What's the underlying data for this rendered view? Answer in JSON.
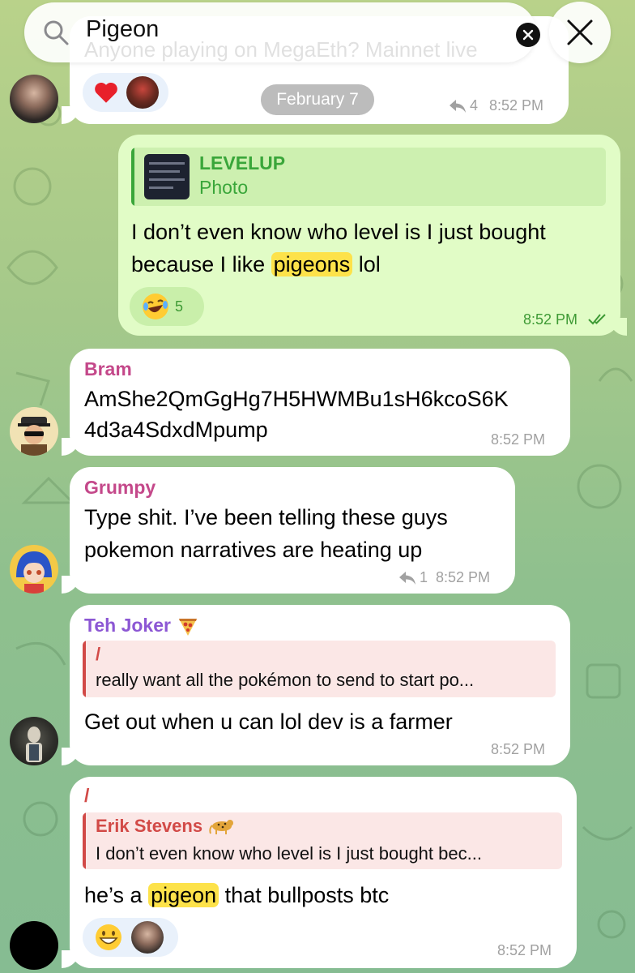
{
  "search": {
    "query": "Pigeon"
  },
  "top_message": {
    "faded_text": "Anyone playing on MegaEth? Mainnet live",
    "date_chip": "February 7",
    "reply_count": "4",
    "time": "8:52 PM"
  },
  "messages": [
    {
      "id": "levelup-reply",
      "quote_title": "LEVELUP",
      "quote_subtitle": "Photo",
      "text_before": "I don’t even know who level is I just bought because I like ",
      "highlight": "pigeons",
      "text_after": " lol",
      "reaction_count": "5",
      "time": "8:52 PM"
    },
    {
      "id": "bram",
      "sender": "Bram",
      "text_line1": "AmShe2QmGgHg7H5HWMBu1sH6kcoS6K",
      "text_line2": "4d3a4SdxdMpump",
      "time": "8:52 PM"
    },
    {
      "id": "grumpy",
      "sender": "Grumpy",
      "text_line1": "Type shit. I’ve been telling these guys",
      "text_line2": "pokemon narratives are heating up",
      "reply_count": "1",
      "time": "8:52 PM"
    },
    {
      "id": "teh-joker",
      "sender": "Teh Joker",
      "quote_title": "/",
      "quote_text": "really want all the pokémon to send to start po...",
      "text": "Get out when u can lol dev is a farmer",
      "time": "8:52 PM"
    },
    {
      "id": "slash",
      "sender": "/",
      "quote_title": "Erik Stevens",
      "quote_text": "I don’t even know who level is I just bought bec...",
      "text_before": "he’s a ",
      "highlight": "pigeon",
      "text_after": " that bullposts btc",
      "time": "8:52 PM"
    }
  ],
  "colors": {
    "bram": "#c4488a",
    "grumpy": "#c4488a",
    "teh_joker": "#8c57d4",
    "slash": "#d24a47",
    "levelup_quote": "#3aa63a",
    "outgoing_bubble": "#e1fcc6",
    "highlight": "#fde24a"
  },
  "icons": {
    "search": "search-icon",
    "clear": "clear-icon",
    "close": "close-icon",
    "heart": "heart-icon",
    "reply": "reply-arrow-icon",
    "read": "double-check-icon",
    "pizza": "pizza-emoji-icon",
    "leopard": "leopard-emoji-icon"
  }
}
